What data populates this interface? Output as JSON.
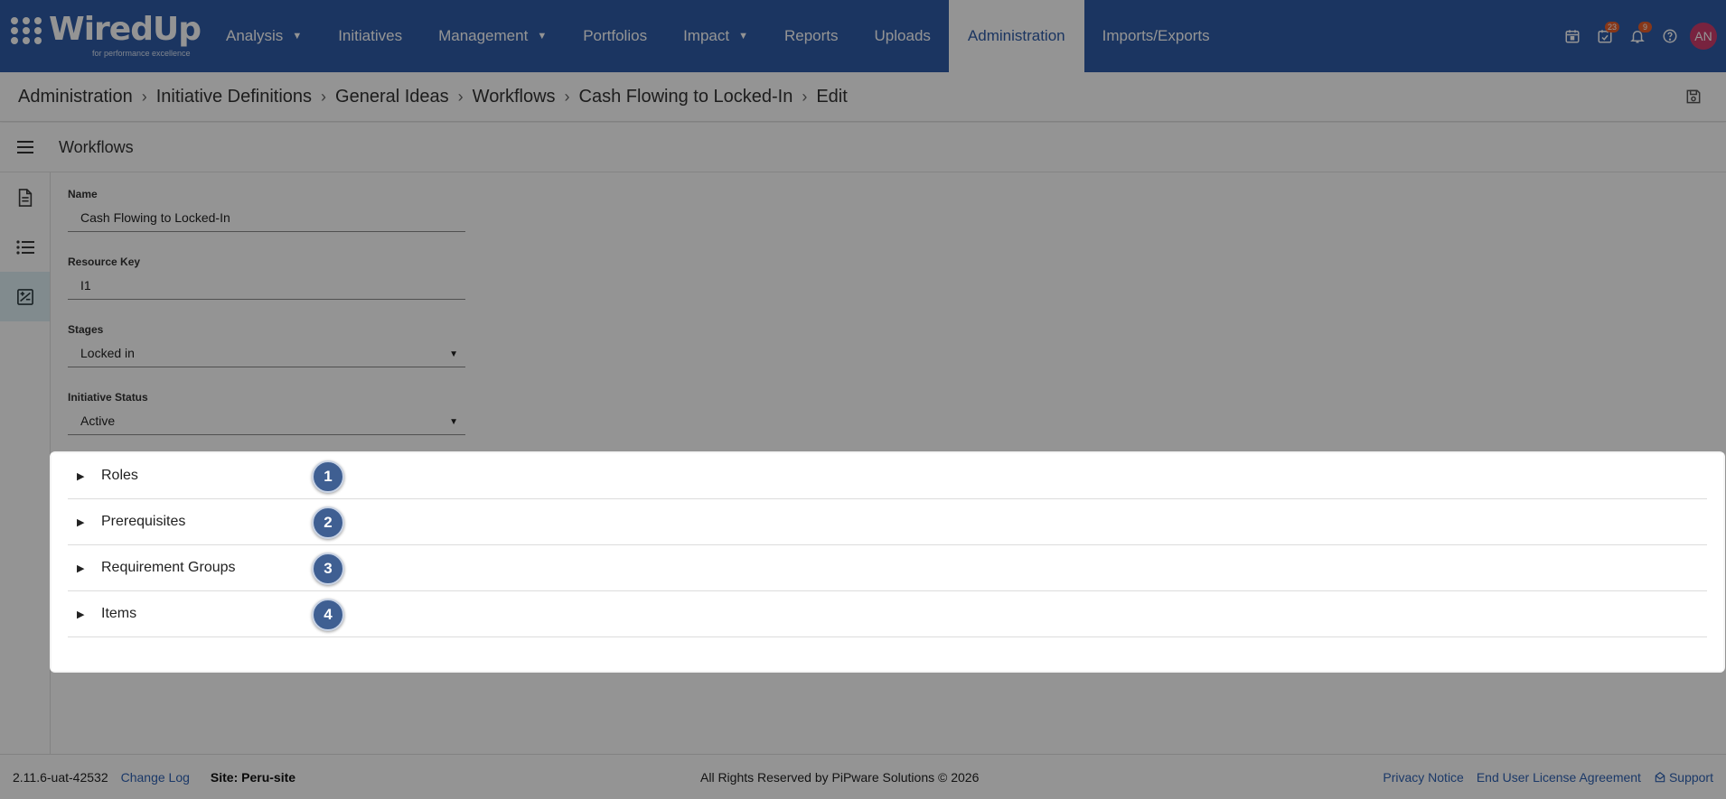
{
  "app": {
    "logo_text": "WiredUp",
    "logo_tagline": "for performance excellence"
  },
  "nav": {
    "items": [
      {
        "label": "Analysis",
        "dropdown": true
      },
      {
        "label": "Initiatives",
        "dropdown": false
      },
      {
        "label": "Management",
        "dropdown": true
      },
      {
        "label": "Portfolios",
        "dropdown": false
      },
      {
        "label": "Impact",
        "dropdown": true
      },
      {
        "label": "Reports",
        "dropdown": false
      },
      {
        "label": "Uploads",
        "dropdown": false
      },
      {
        "label": "Administration",
        "dropdown": false,
        "active": true
      },
      {
        "label": "Imports/Exports",
        "dropdown": false
      }
    ],
    "tasks_badge": "23",
    "notifications_badge": "9",
    "avatar_initials": "AN"
  },
  "breadcrumb": [
    "Administration",
    "Initiative Definitions",
    "General Ideas",
    "Workflows",
    "Cash Flowing to Locked-In",
    "Edit"
  ],
  "section": {
    "title": "Workflows"
  },
  "form": {
    "name_label": "Name",
    "name_value": "Cash Flowing to Locked-In",
    "resource_key_label": "Resource Key",
    "resource_key_value": "I1",
    "stages_label": "Stages",
    "stages_value": "Locked in",
    "status_label": "Initiative Status",
    "status_value": "Active"
  },
  "accordion": [
    {
      "label": "Roles",
      "badge": "1"
    },
    {
      "label": "Prerequisites",
      "badge": "2"
    },
    {
      "label": "Requirement Groups",
      "badge": "3"
    },
    {
      "label": "Items",
      "badge": "4"
    }
  ],
  "footer": {
    "version": "2.11.6-uat-42532",
    "changelog": "Change Log",
    "site": "Site: Peru-site",
    "copyright": "All Rights Reserved by PiPware Solutions © 2026",
    "privacy": "Privacy Notice",
    "eula": "End User License Agreement",
    "support": "Support"
  },
  "colors": {
    "nav_bg": "#2f5ca8",
    "badge": "#e8602c",
    "avatar": "#cf3d6d",
    "link": "#2f62b4",
    "step_badge": "#3f5f92"
  }
}
